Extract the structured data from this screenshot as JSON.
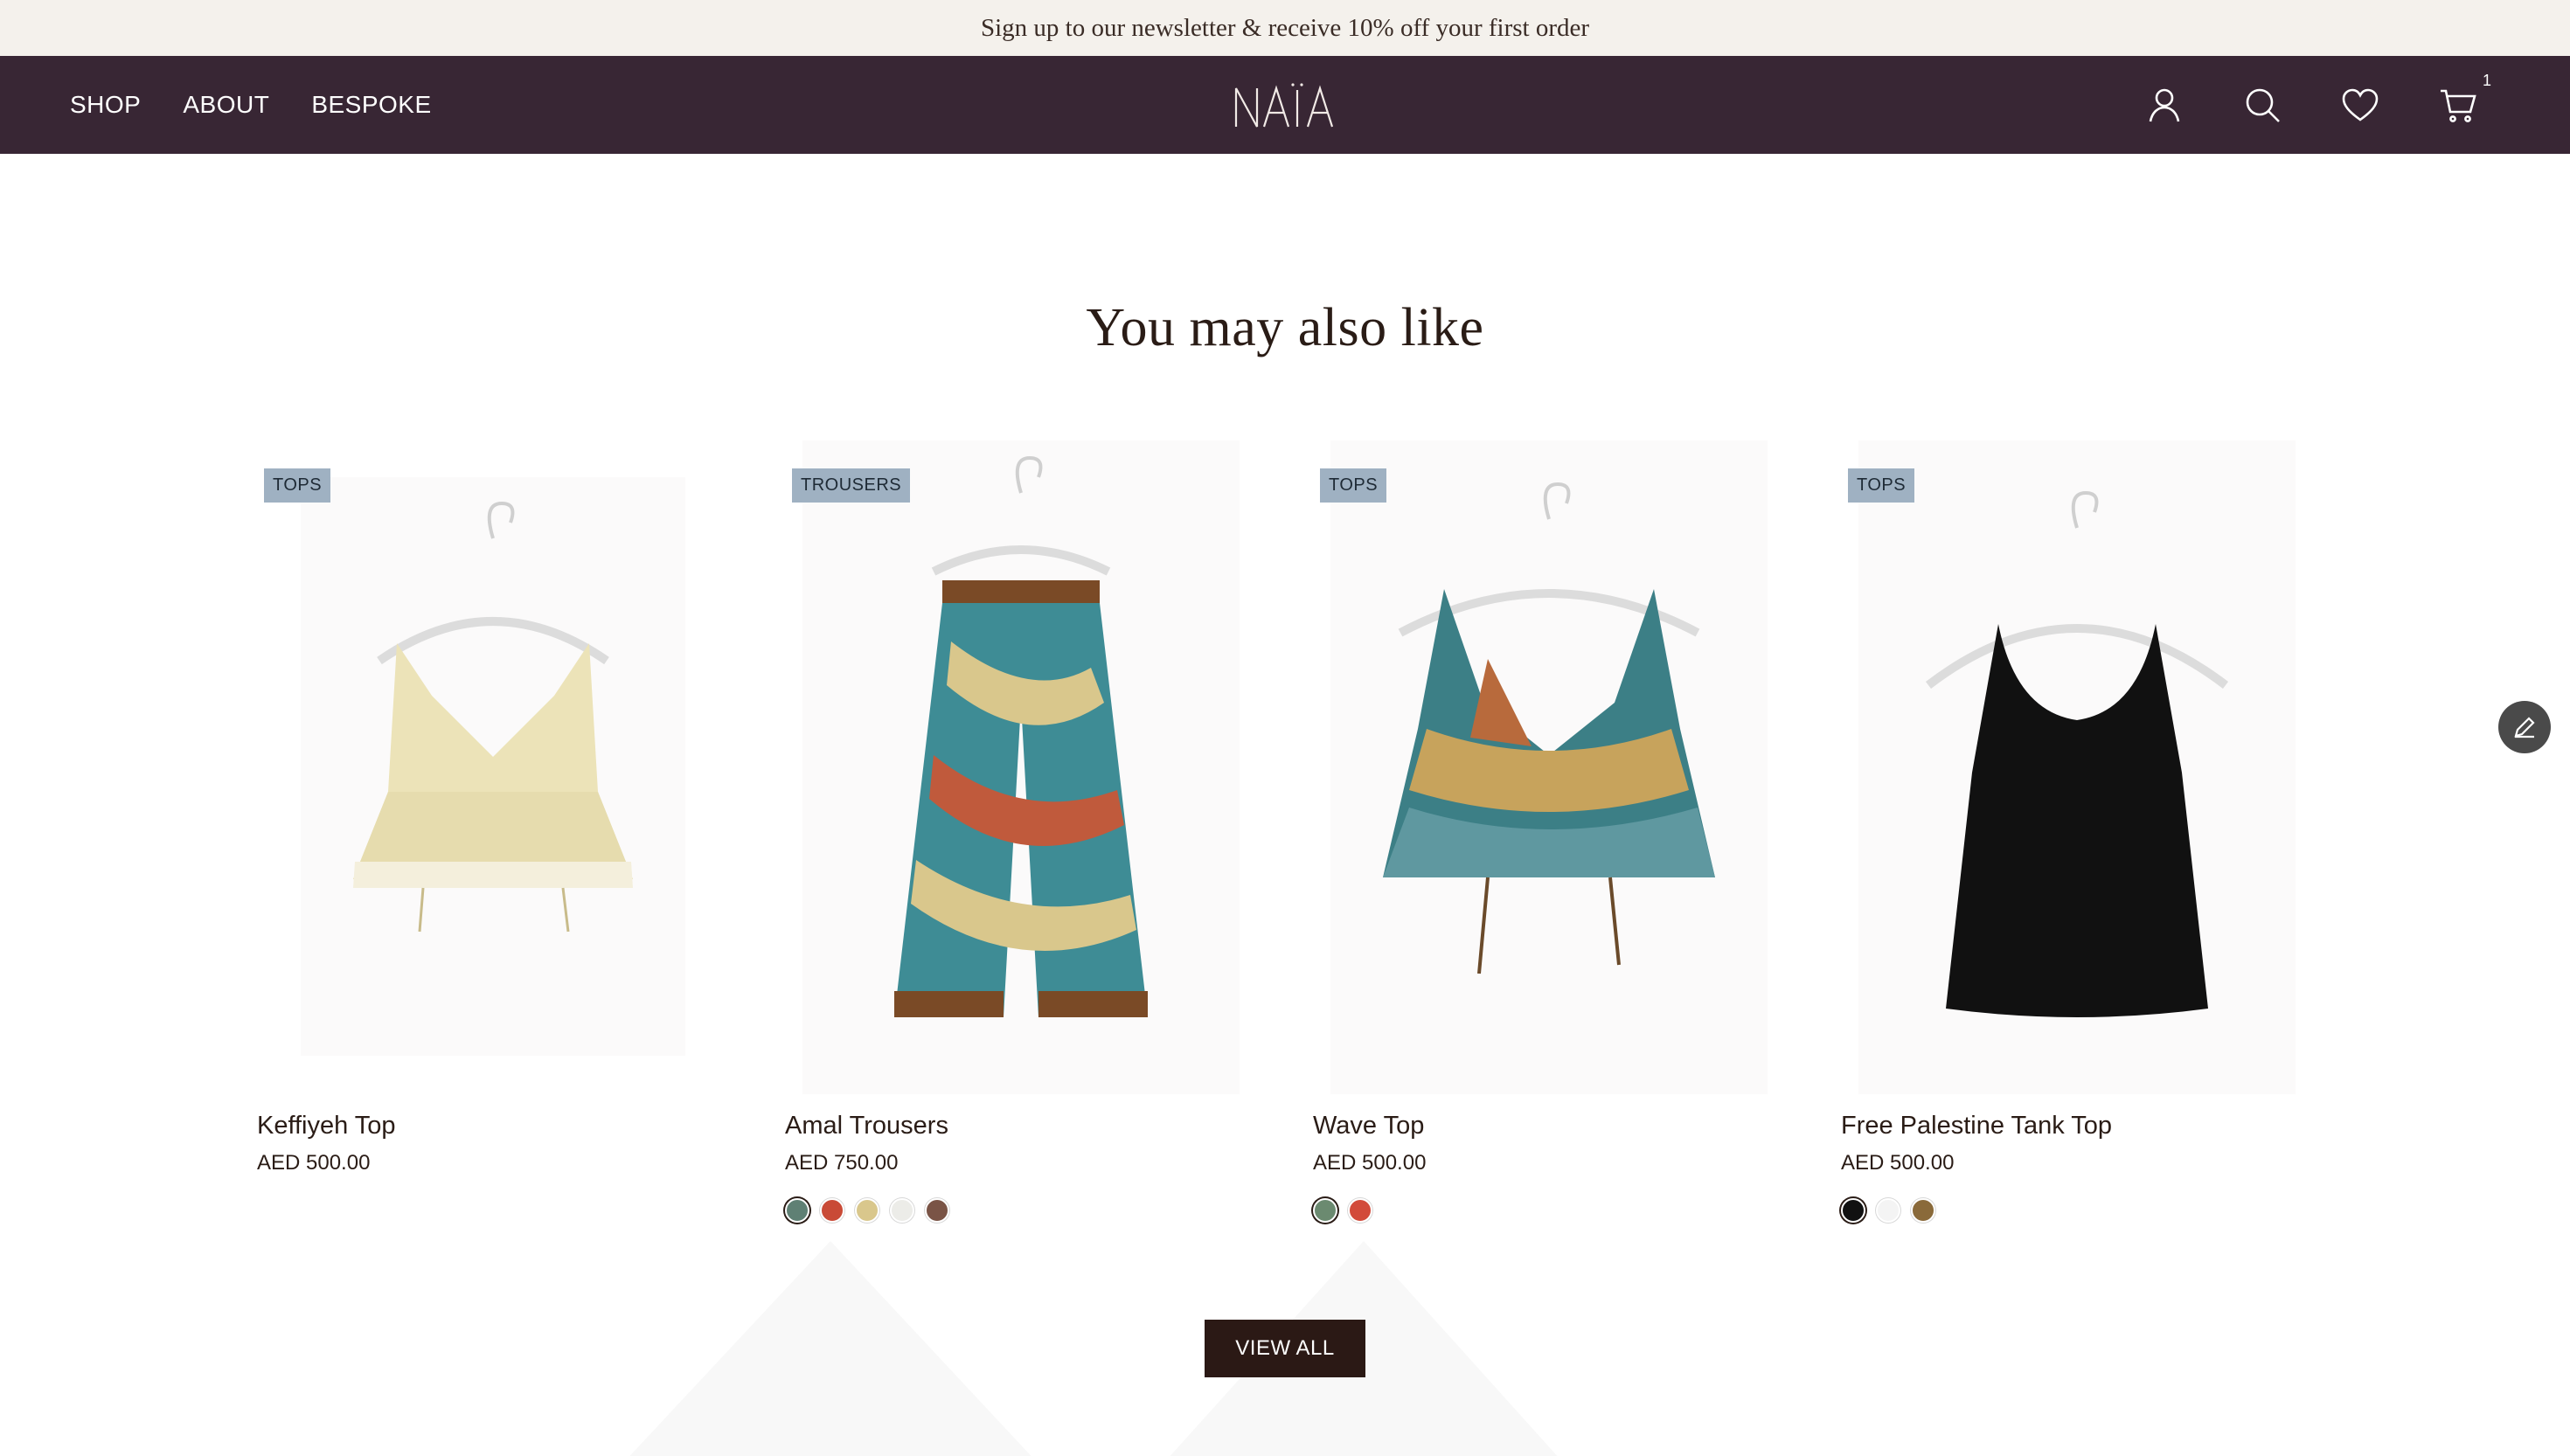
{
  "announcement": {
    "text": "Sign up to our newsletter & receive 10% off your first order"
  },
  "header": {
    "nav": [
      "SHOP",
      "ABOUT",
      "BESPOKE"
    ],
    "logo": "NAÏA",
    "icons": [
      "account-icon",
      "search-icon",
      "wishlist-heart-icon",
      "cart-icon"
    ],
    "cart_count": "1"
  },
  "section": {
    "title": "You may also like"
  },
  "products": [
    {
      "tag": "TOPS",
      "name": "Keffiyeh Top",
      "price": "AED 500.00",
      "swatches": []
    },
    {
      "tag": "TROUSERS",
      "name": "Amal Trousers",
      "price": "AED 750.00",
      "swatches": [
        "#5f8074",
        "#c94a36",
        "#d9c78c",
        "#ecece8",
        "#7a5446"
      ]
    },
    {
      "tag": "TOPS",
      "name": "Wave Top",
      "price": "AED 500.00",
      "swatches": [
        "#6b8a70",
        "#d24a3a"
      ]
    },
    {
      "tag": "TOPS",
      "name": "Free Palestine Tank Top",
      "price": "AED 500.00",
      "swatches": [
        "#111111",
        "#f4f4f4",
        "#8a6a3a"
      ]
    }
  ],
  "view_all": {
    "label": "VIEW ALL"
  },
  "colors": {
    "announcement_bg": "#f4f1ec",
    "header_bg": "#382634",
    "tag_bg": "#9fb1c2",
    "button_bg": "#2b1915"
  }
}
